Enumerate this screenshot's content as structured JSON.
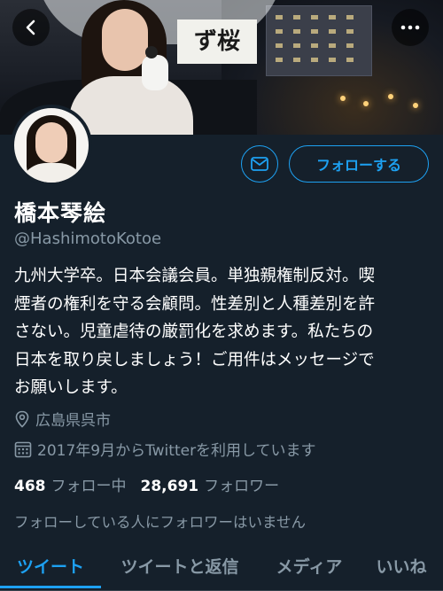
{
  "header": {
    "banner_sign_text": "ず桜",
    "back_icon": "chevron-left-icon",
    "more_icon": "more-horizontal-icon"
  },
  "profile": {
    "name": "橋本琴絵",
    "handle": "@HashimotoKotoe",
    "bio": "九州大学卒。日本会議会員。単独親権制反対。喫\n煙者の権利を守る会顧問。性差別と人種差別を許\nさない。児童虐待の厳罰化を求めます。私たちの\n日本を取り戻しましょう！ご用件はメッセージで\nお願いします。",
    "location": "広島県呉市",
    "joined": "2017年9月からTwitterを利用しています"
  },
  "actions": {
    "follow_label": "フォローする",
    "message_icon": "envelope-icon"
  },
  "stats": {
    "following_count": "468",
    "following_label": "フォロー中",
    "followers_count": "28,691",
    "followers_label": "フォロワー"
  },
  "followers_note": "フォローしている人にフォロワーはいません",
  "tabs": [
    {
      "label": "ツイート",
      "active": true
    },
    {
      "label": "ツイートと返信",
      "active": false
    },
    {
      "label": "メディア",
      "active": false
    },
    {
      "label": "いいね",
      "active": false
    }
  ],
  "colors": {
    "background": "#15202b",
    "accent": "#1da1f2",
    "secondary_text": "#8899a6"
  }
}
